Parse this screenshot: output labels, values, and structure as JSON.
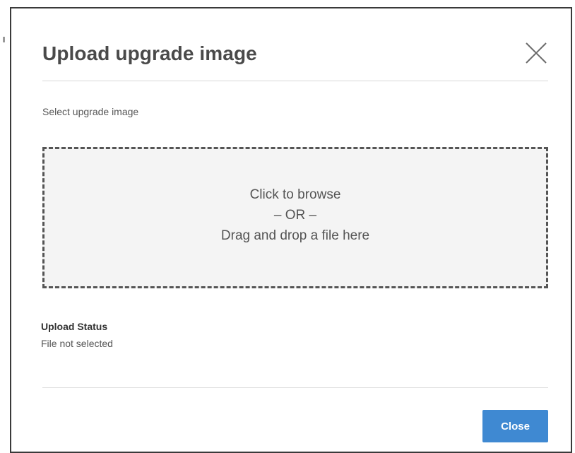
{
  "dialog": {
    "title": "Upload upgrade image",
    "close_icon": "close-icon",
    "select_label": "Select upgrade image",
    "dropzone": {
      "line1": "Click to browse",
      "line2": "– OR –",
      "line3": "Drag and drop a file here"
    },
    "status": {
      "title": "Upload Status",
      "value": "File not selected"
    },
    "footer": {
      "close_label": "Close"
    }
  },
  "colors": {
    "primary_button": "#3f89d2",
    "title_text": "#4a4a4a",
    "dropzone_border": "#555555"
  }
}
